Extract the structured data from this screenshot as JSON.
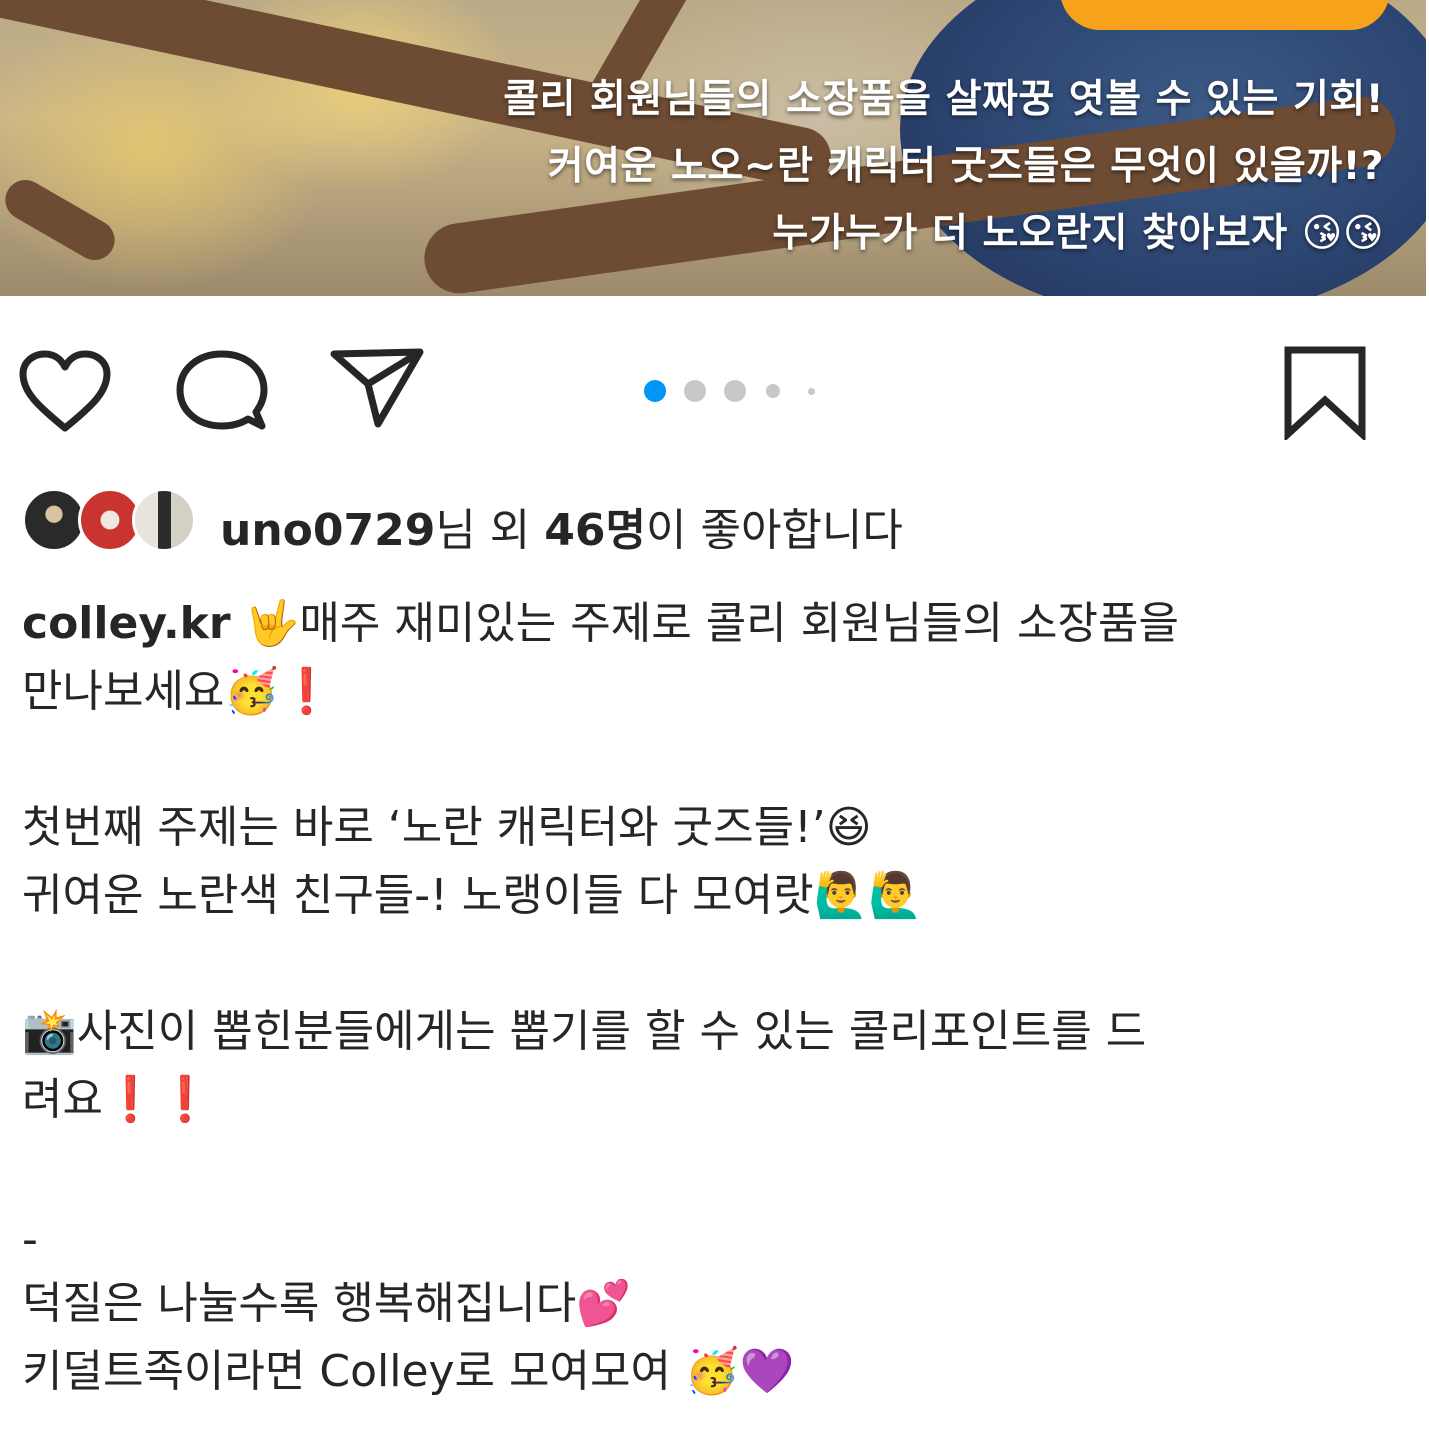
{
  "post_image": {
    "overlay_lines": [
      "콜리 회원님들의 소장품을 살짜꿍 엿볼 수 있는 기회!",
      "커여운 노오~란 캐릭터 굿즈들은 무엇이 있을까!?",
      "누가누가 더 노오란지 찾아보자 😘😘"
    ]
  },
  "actions": {
    "like_icon": "heart-icon",
    "comment_icon": "comment-icon",
    "share_icon": "paper-plane-icon",
    "save_icon": "bookmark-icon",
    "carousel": {
      "total": 5,
      "active": 1,
      "active_color": "#0095f6"
    }
  },
  "likes": {
    "user": "uno0729",
    "middle": "님 외 ",
    "count": "46명",
    "suffix": "이 좋아합니다"
  },
  "caption": {
    "username": "colley.kr",
    "lines": [
      "🤟매주 재미있는 주제로 콜리 회원님들의 소장품을",
      "만나보세요🥳❗",
      "",
      "첫번째 주제는 바로 ‘노란 캐릭터와 굿즈들!’😆",
      "귀여운 노란색 친구들-! 노랭이들 다 모여랏🙋‍♂️🙋‍♂️",
      "",
      "📸사진이 뽑힌분들에게는 뽑기를 할 수 있는 콜리포인트를 드",
      "려요❗❗",
      "",
      "",
      "-",
      "덕질은 나눌수록 행복해집니다💕",
      "키덜트족이라면 Colley로 모여모여 🥳💜"
    ]
  }
}
